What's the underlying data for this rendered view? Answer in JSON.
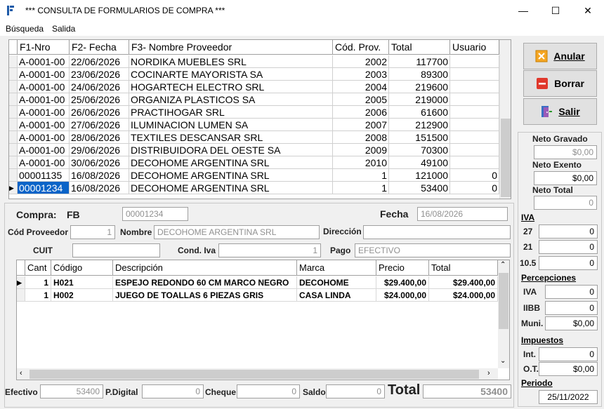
{
  "window": {
    "title": "*** CONSULTA DE FORMULARIOS DE COMPRA  ***",
    "min_glyph": "—",
    "max_glyph": "☐",
    "close_glyph": "✕"
  },
  "menu": {
    "items": [
      "Búsqueda",
      "Salida"
    ]
  },
  "grid": {
    "columns": [
      "F1-Nro",
      "F2- Fecha",
      "F3- Nombre Proveedor",
      "Cód. Prov.",
      "Total",
      "Usuario"
    ],
    "rows": [
      {
        "nro": "A-0001-00",
        "fecha": "22/06/2026",
        "nombre": "NORDIKA MUEBLES SRL",
        "cod": "2002",
        "total": "117700",
        "usuario": ""
      },
      {
        "nro": "A-0001-00",
        "fecha": "23/06/2026",
        "nombre": "COCINARTE MAYORISTA SA",
        "cod": "2003",
        "total": "89300",
        "usuario": ""
      },
      {
        "nro": "A-0001-00",
        "fecha": "24/06/2026",
        "nombre": "HOGARTECH ELECTRO SRL",
        "cod": "2004",
        "total": "219600",
        "usuario": ""
      },
      {
        "nro": "A-0001-00",
        "fecha": "25/06/2026",
        "nombre": "ORGANIZA PLASTICOS SA",
        "cod": "2005",
        "total": "219000",
        "usuario": ""
      },
      {
        "nro": "A-0001-00",
        "fecha": "26/06/2026",
        "nombre": "PRACTIHOGAR SRL",
        "cod": "2006",
        "total": "61600",
        "usuario": ""
      },
      {
        "nro": "A-0001-00",
        "fecha": "27/06/2026",
        "nombre": "ILUMINACION LUMEN SA",
        "cod": "2007",
        "total": "212900",
        "usuario": ""
      },
      {
        "nro": "A-0001-00",
        "fecha": "28/06/2026",
        "nombre": "TEXTILES DESCANSAR SRL",
        "cod": "2008",
        "total": "151500",
        "usuario": ""
      },
      {
        "nro": "A-0001-00",
        "fecha": "29/06/2026",
        "nombre": "DISTRIBUIDORA DEL OESTE SA",
        "cod": "2009",
        "total": "70300",
        "usuario": ""
      },
      {
        "nro": "A-0001-00",
        "fecha": "30/06/2026",
        "nombre": "DECOHOME ARGENTINA SRL",
        "cod": "2010",
        "total": "49100",
        "usuario": ""
      },
      {
        "nro": "00001135",
        "fecha": "16/08/2026",
        "nombre": "DECOHOME ARGENTINA SRL",
        "cod": "1",
        "total": "121000",
        "usuario": "0"
      },
      {
        "nro": "00001234",
        "fecha": "16/08/2026",
        "nombre": "DECOHOME ARGENTINA SRL",
        "cod": "1",
        "total": "53400",
        "usuario": "0"
      }
    ]
  },
  "buttons": {
    "anular": "Anular",
    "borrar": "Borrar",
    "salir": "Salir"
  },
  "form": {
    "compra_label": "Compra:",
    "compra_tipo": "FB",
    "compra_nro": "00001234",
    "fecha_label": "Fecha",
    "fecha": "16/08/2026",
    "cod_prov_label": "Cód Proveedor",
    "cod_prov": "1",
    "nombre_label": "Nombre",
    "nombre": "DECOHOME ARGENTINA SRL",
    "direccion_label": "Dirección",
    "direccion": "",
    "cuit_label": "CUIT",
    "cuit": "",
    "cond_iva_label": "Cond. Iva",
    "cond_iva": "1",
    "pago_label": "Pago",
    "pago": "EFECTIVO"
  },
  "detail": {
    "columns": [
      "Cant",
      "Código",
      "Descripción",
      "Marca",
      "Precio",
      "Total"
    ],
    "rows": [
      {
        "cant": "1",
        "codigo": "H021",
        "desc": "ESPEJO REDONDO 60 CM MARCO NEGRO",
        "marca": "DECOHOME",
        "precio": "$29.400,00",
        "total": "$29.400,00"
      },
      {
        "cant": "1",
        "codigo": "H002",
        "desc": "JUEGO DE TOALLAS 6 PIEZAS GRIS",
        "marca": "CASA LINDA",
        "precio": "$24.000,00",
        "total": "$24.000,00"
      }
    ]
  },
  "totals": {
    "efectivo_label": "Efectivo",
    "efectivo": "53400",
    "pdigital_label": "P.Digital",
    "pdigital": "0",
    "cheque_label": "Cheque",
    "cheque": "0",
    "saldo_label": "Saldo",
    "saldo": "0",
    "total_label": "Total",
    "total": "53400"
  },
  "side": {
    "neto_gravado_label": "Neto Gravado",
    "neto_gravado": "$0,00",
    "neto_exento_label": "Neto Exento",
    "neto_exento": "$0,00",
    "neto_total_label": "Neto Total",
    "neto_total": "0",
    "iva_label": "IVA",
    "iva27_label": "27",
    "iva27": "0",
    "iva21_label": "21",
    "iva21": "0",
    "iva105_label": "10.5",
    "iva105": "0",
    "percep_label": "Percepciones",
    "p_iva_label": "IVA",
    "p_iva": "0",
    "p_iibb_label": "IIBB",
    "p_iibb": "0",
    "p_muni_label": "Muni.",
    "p_muni": "$0,00",
    "imp_label": "Impuestos",
    "int_label": "Int.",
    "int": "0",
    "ot_label": "O.T.",
    "ot": "$0,00",
    "periodo_label": "Periodo",
    "periodo": "25/11/2022"
  }
}
